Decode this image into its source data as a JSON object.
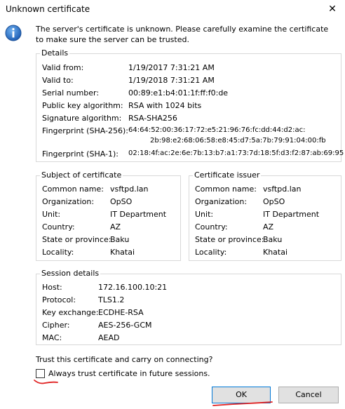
{
  "window": {
    "title": "Unknown certificate",
    "close_glyph": "✕"
  },
  "message": {
    "line1": "The server's certificate is unknown. Please carefully examine the certificate",
    "line2": "to make sure the server can be trusted.",
    "icon": "info-icon"
  },
  "details": {
    "legend": "Details",
    "rows": [
      {
        "label": "Valid from:",
        "value": "1/19/2017 7:31:21 AM"
      },
      {
        "label": "Valid to:",
        "value": "1/19/2018 7:31:21 AM"
      },
      {
        "label": "Serial number:",
        "value": "00:89:e1:b4:01:1f:ff:f0:de"
      },
      {
        "label": "Public key algorithm:",
        "value": "RSA with 1024 bits"
      },
      {
        "label": "Signature algorithm:",
        "value": "RSA-SHA256"
      }
    ],
    "fp256_label": "Fingerprint (SHA-256):",
    "fp256_line1": "64:64:52:00:36:17:72:e5:21:96:76:fc:dd:44:d2:ac:",
    "fp256_line2": "2b:98:e2:68:06:58:e8:45:d7:5a:7b:79:91:04:00:fb",
    "fp1_label": "Fingerprint (SHA-1):",
    "fp1_value": "02:18:4f:ac:2e:6e:7b:13:b7:a1:73:7d:18:5f:d3:f2:87:ab:69:95"
  },
  "subject": {
    "legend": "Subject of certificate",
    "rows": [
      {
        "label": "Common name:",
        "value": "vsftpd.lan"
      },
      {
        "label": "Organization:",
        "value": "OpSO"
      },
      {
        "label": "Unit:",
        "value": "IT Department"
      },
      {
        "label": "Country:",
        "value": "AZ"
      },
      {
        "label": "State or province:",
        "value": "Baku"
      },
      {
        "label": "Locality:",
        "value": "Khatai"
      }
    ]
  },
  "issuer": {
    "legend": "Certificate issuer",
    "rows": [
      {
        "label": "Common name:",
        "value": "vsftpd.lan"
      },
      {
        "label": "Organization:",
        "value": "OpSO"
      },
      {
        "label": "Unit:",
        "value": "IT Department"
      },
      {
        "label": "Country:",
        "value": "AZ"
      },
      {
        "label": "State or province:",
        "value": "Baku"
      },
      {
        "label": "Locality:",
        "value": "Khatai"
      }
    ]
  },
  "session": {
    "legend": "Session details",
    "rows": [
      {
        "label": "Host:",
        "value": "172.16.100.10:21"
      },
      {
        "label": "Protocol:",
        "value": "TLS1.2"
      },
      {
        "label": "Key exchange:",
        "value": "ECDHE-RSA"
      },
      {
        "label": "Cipher:",
        "value": "AES-256-GCM"
      },
      {
        "label": "MAC:",
        "value": "AEAD"
      }
    ]
  },
  "trust": {
    "question": "Trust this certificate and carry on connecting?",
    "always_label": "Always trust certificate in future sessions.",
    "always_checked": false
  },
  "buttons": {
    "ok": "OK",
    "cancel": "Cancel"
  },
  "colors": {
    "annotation_red": "#e02020",
    "icon_blue": "#1f6fc9"
  }
}
